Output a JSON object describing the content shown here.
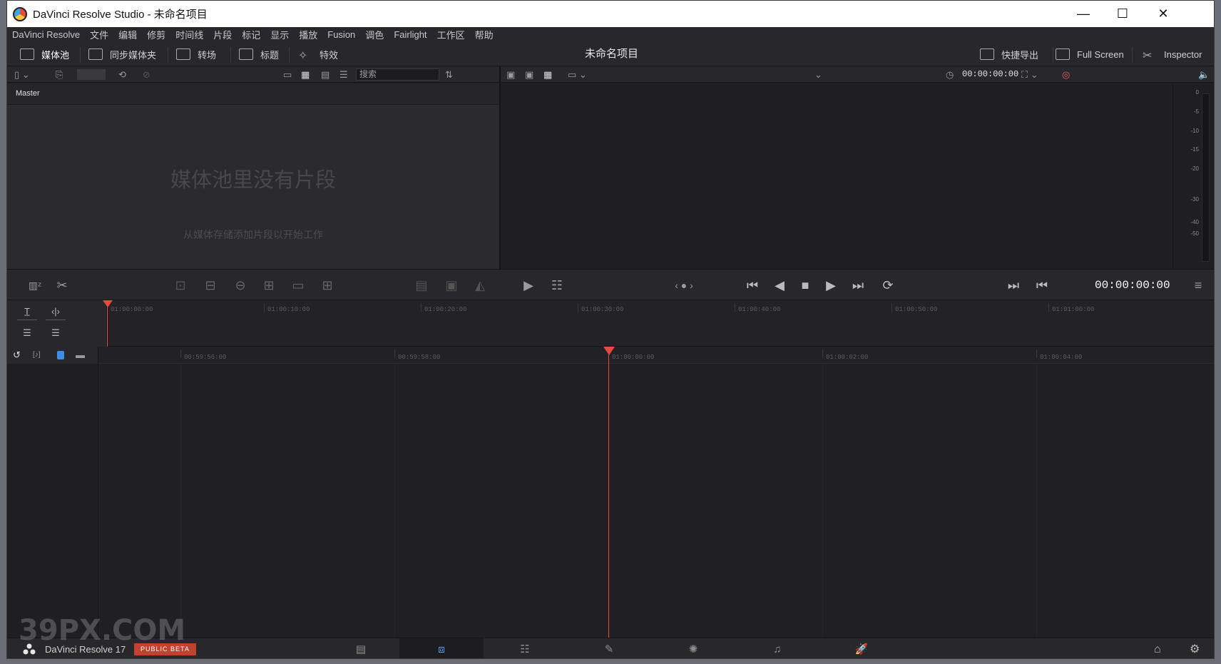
{
  "window": {
    "title": "DaVinci Resolve Studio - 未命名项目",
    "minimize": "—",
    "maximize": "☐",
    "close": "✕"
  },
  "menu": [
    "DaVinci Resolve",
    "文件",
    "编辑",
    "修剪",
    "时间线",
    "片段",
    "标记",
    "显示",
    "播放",
    "Fusion",
    "调色",
    "Fairlight",
    "工作区",
    "帮助"
  ],
  "toolbar": {
    "media_pool": "媒体池",
    "sync_bin": "同步媒体夹",
    "transitions": "转场",
    "titles": "标题",
    "effects": "特效",
    "project_title": "未命名项目",
    "quick_export": "快捷导出",
    "full_screen": "Full Screen",
    "inspector": "Inspector"
  },
  "media_pool": {
    "search_placeholder": "搜索",
    "bin": "Master",
    "empty_title": "媒体池里没有片段",
    "empty_hint": "从媒体存储添加片段以开始工作"
  },
  "viewer": {
    "timecode_top": "00:00:00:00",
    "timecode_main": "00:00:00:00"
  },
  "meters": {
    "labels": [
      "0",
      "-5",
      "-10",
      "-15",
      "-20",
      "-30",
      "-40",
      "-50"
    ]
  },
  "upper_ruler": [
    "01:00:00:00",
    "01:00:10:00",
    "01:00:20:00",
    "01:00:30:00",
    "01:00:40:00",
    "01:00:50:00",
    "01:01:00:00"
  ],
  "lower_ruler": [
    "00:59:56:00",
    "00:59:58:00",
    "01:00:00:00",
    "01:00:02:00",
    "01:00:04:00"
  ],
  "bottom": {
    "app_name": "DaVinci Resolve 17",
    "badge": "PUBLIC BETA",
    "active_page": "cut"
  },
  "watermark": "39PX.COM",
  "colors": {
    "playhead": "#e54b41",
    "accent": "#5aa6ff",
    "beta_badge": "#c4412d"
  }
}
